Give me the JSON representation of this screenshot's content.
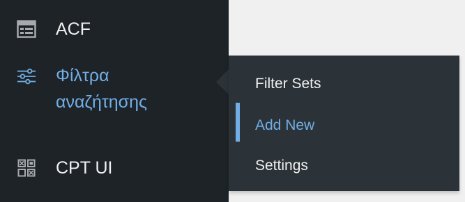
{
  "colors": {
    "menu_bg": "#1d2327",
    "submenu_bg": "#2c3338",
    "text": "#f0f0f1",
    "accent": "#72aee6",
    "page_bg": "#f0f0f1"
  },
  "menu": {
    "items": [
      {
        "label": "ACF",
        "icon": "table-grid-icon"
      },
      {
        "label": "Φίλτρα αναζήτησης",
        "icon": "sliders-icon"
      },
      {
        "label": "CPT UI",
        "icon": "blocks-grid-icon"
      }
    ]
  },
  "submenu": {
    "items": [
      {
        "label": "Filter Sets"
      },
      {
        "label": "Add New",
        "current": true
      },
      {
        "label": "Settings"
      }
    ]
  }
}
